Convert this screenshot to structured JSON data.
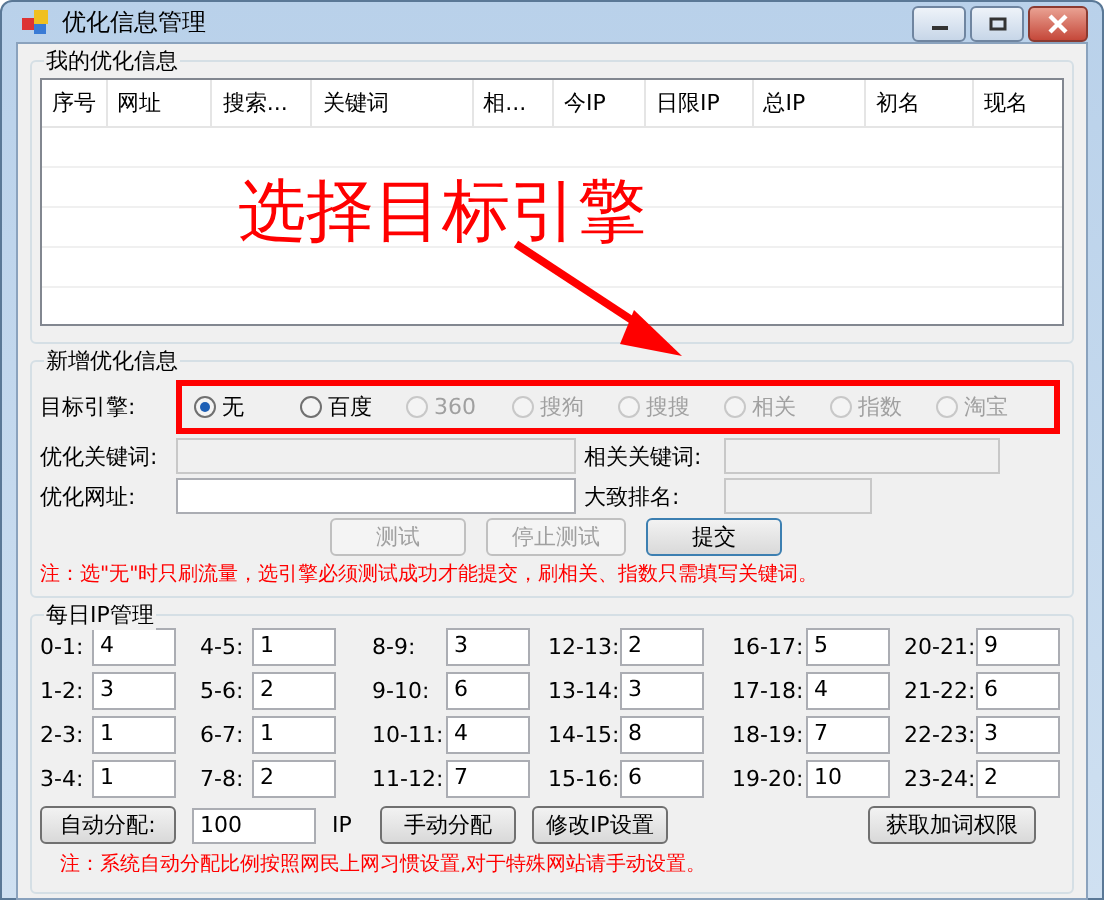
{
  "window": {
    "title": "优化信息管理"
  },
  "my_info": {
    "title": "我的优化信息",
    "columns": [
      "序号",
      "网址",
      "搜索...",
      "关键词",
      "相...",
      "今IP",
      "日限IP",
      "总IP",
      "初名",
      "现名"
    ]
  },
  "new_info": {
    "title": "新增优化信息",
    "engine_label": "目标引擎:",
    "engines": [
      {
        "label": "无",
        "selected": true,
        "disabled": false
      },
      {
        "label": "百度",
        "selected": false,
        "disabled": false
      },
      {
        "label": "360",
        "selected": false,
        "disabled": true
      },
      {
        "label": "搜狗",
        "selected": false,
        "disabled": true
      },
      {
        "label": "搜搜",
        "selected": false,
        "disabled": true
      },
      {
        "label": "相关",
        "selected": false,
        "disabled": true
      },
      {
        "label": "指数",
        "selected": false,
        "disabled": true
      },
      {
        "label": "淘宝",
        "selected": false,
        "disabled": true
      }
    ],
    "keyword_label": "优化关键词:",
    "keyword_disabled": true,
    "related_label": "相关关键词:",
    "related_disabled": true,
    "url_label": "优化网址:",
    "url_disabled": false,
    "rank_label": "大致排名:",
    "rank_disabled": true,
    "buttons": [
      {
        "label": "测试",
        "disabled": true
      },
      {
        "label": "停止测试",
        "disabled": true
      },
      {
        "label": "提交",
        "disabled": false
      }
    ],
    "note": "注：选\"无\"时只刷流量，选引擎必须测试成功才能提交，刷相关、指数只需填写关键词。"
  },
  "ip_management": {
    "title": "每日IP管理",
    "columns": [
      [
        {
          "label": "0-1:",
          "value": "4"
        },
        {
          "label": "1-2:",
          "value": "3"
        },
        {
          "label": "2-3:",
          "value": "1"
        },
        {
          "label": "3-4:",
          "value": "1"
        }
      ],
      [
        {
          "label": "4-5:",
          "value": "1"
        },
        {
          "label": "5-6:",
          "value": "2"
        },
        {
          "label": "6-7:",
          "value": "1"
        },
        {
          "label": "7-8:",
          "value": "2"
        }
      ],
      [
        {
          "label": "8-9:",
          "value": "3"
        },
        {
          "label": "9-10:",
          "value": "6"
        },
        {
          "label": "10-11:",
          "value": "4"
        },
        {
          "label": "11-12:",
          "value": "7"
        }
      ],
      [
        {
          "label": "12-13:",
          "value": "2"
        },
        {
          "label": "13-14:",
          "value": "3"
        },
        {
          "label": "14-15:",
          "value": "8"
        },
        {
          "label": "15-16:",
          "value": "6"
        }
      ],
      [
        {
          "label": "16-17:",
          "value": "5"
        },
        {
          "label": "17-18:",
          "value": "4"
        },
        {
          "label": "18-19:",
          "value": "7"
        },
        {
          "label": "19-20:",
          "value": "10"
        }
      ],
      [
        {
          "label": "20-21:",
          "value": "9"
        },
        {
          "label": "21-22:",
          "value": "6"
        },
        {
          "label": "22-23:",
          "value": "3"
        },
        {
          "label": "23-24:",
          "value": "2"
        }
      ]
    ],
    "auto_button": "自动分配:",
    "total": "100",
    "unit": "IP",
    "manual_button": "手动分配",
    "settings_button": "修改IP设置",
    "permission_button": "获取加词权限",
    "note": "注：系统自动分配比例按照网民上网习惯设置,对于特殊网站请手动设置。"
  },
  "annotation": {
    "text": "选择目标引擎"
  }
}
